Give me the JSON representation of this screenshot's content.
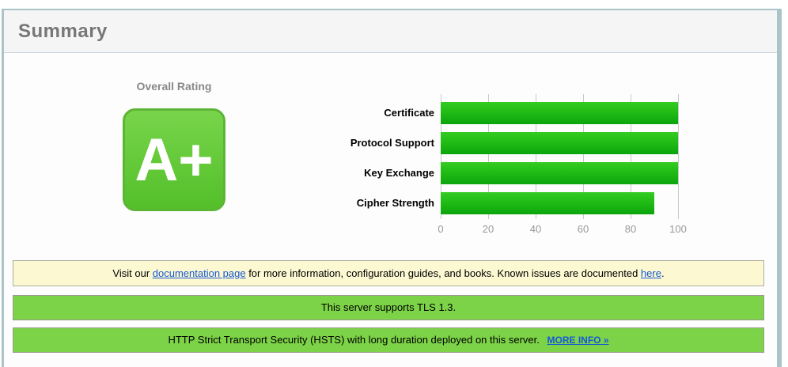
{
  "header": {
    "title": "Summary"
  },
  "rating": {
    "label": "Overall Rating",
    "grade": "A+"
  },
  "chart_data": {
    "type": "bar",
    "orientation": "horizontal",
    "title": "",
    "categories": [
      "Certificate",
      "Protocol Support",
      "Key Exchange",
      "Cipher Strength"
    ],
    "values": [
      100,
      100,
      100,
      90
    ],
    "xlim": [
      0,
      100
    ],
    "ticks": [
      0,
      20,
      40,
      60,
      80,
      100
    ],
    "grid": true,
    "bar_color_top": "#34cc23",
    "bar_color_bottom": "#0ba50c"
  },
  "notes": {
    "documentation": {
      "segments": [
        {
          "text": "Visit our "
        },
        {
          "text": "documentation page",
          "link": true,
          "name": "documentation-page-link"
        },
        {
          "text": " for more information, configuration guides, and books. Known issues are documented "
        },
        {
          "text": "here",
          "link": true,
          "name": "known-issues-link"
        },
        {
          "text": "."
        }
      ]
    },
    "tls": {
      "text": "This server supports TLS 1.3."
    },
    "hsts": {
      "text": "HTTP Strict Transport Security (HSTS) with long duration deployed on this server.",
      "link_label": "MORE INFO »"
    }
  },
  "colors": {
    "panel_border": "#aac4c8",
    "header_bg": "#f5f5f5",
    "header_text": "#777777",
    "grade_green_border": "#5cb535",
    "grade_green_top": "#79d44b",
    "grade_green_bottom": "#54bf2b",
    "note_yellow_bg": "#fcf8d2",
    "note_green_bg": "#7dd348",
    "link_blue": "#1558d6",
    "gridline": "#c9c9c9",
    "tick_text": "#999999"
  }
}
